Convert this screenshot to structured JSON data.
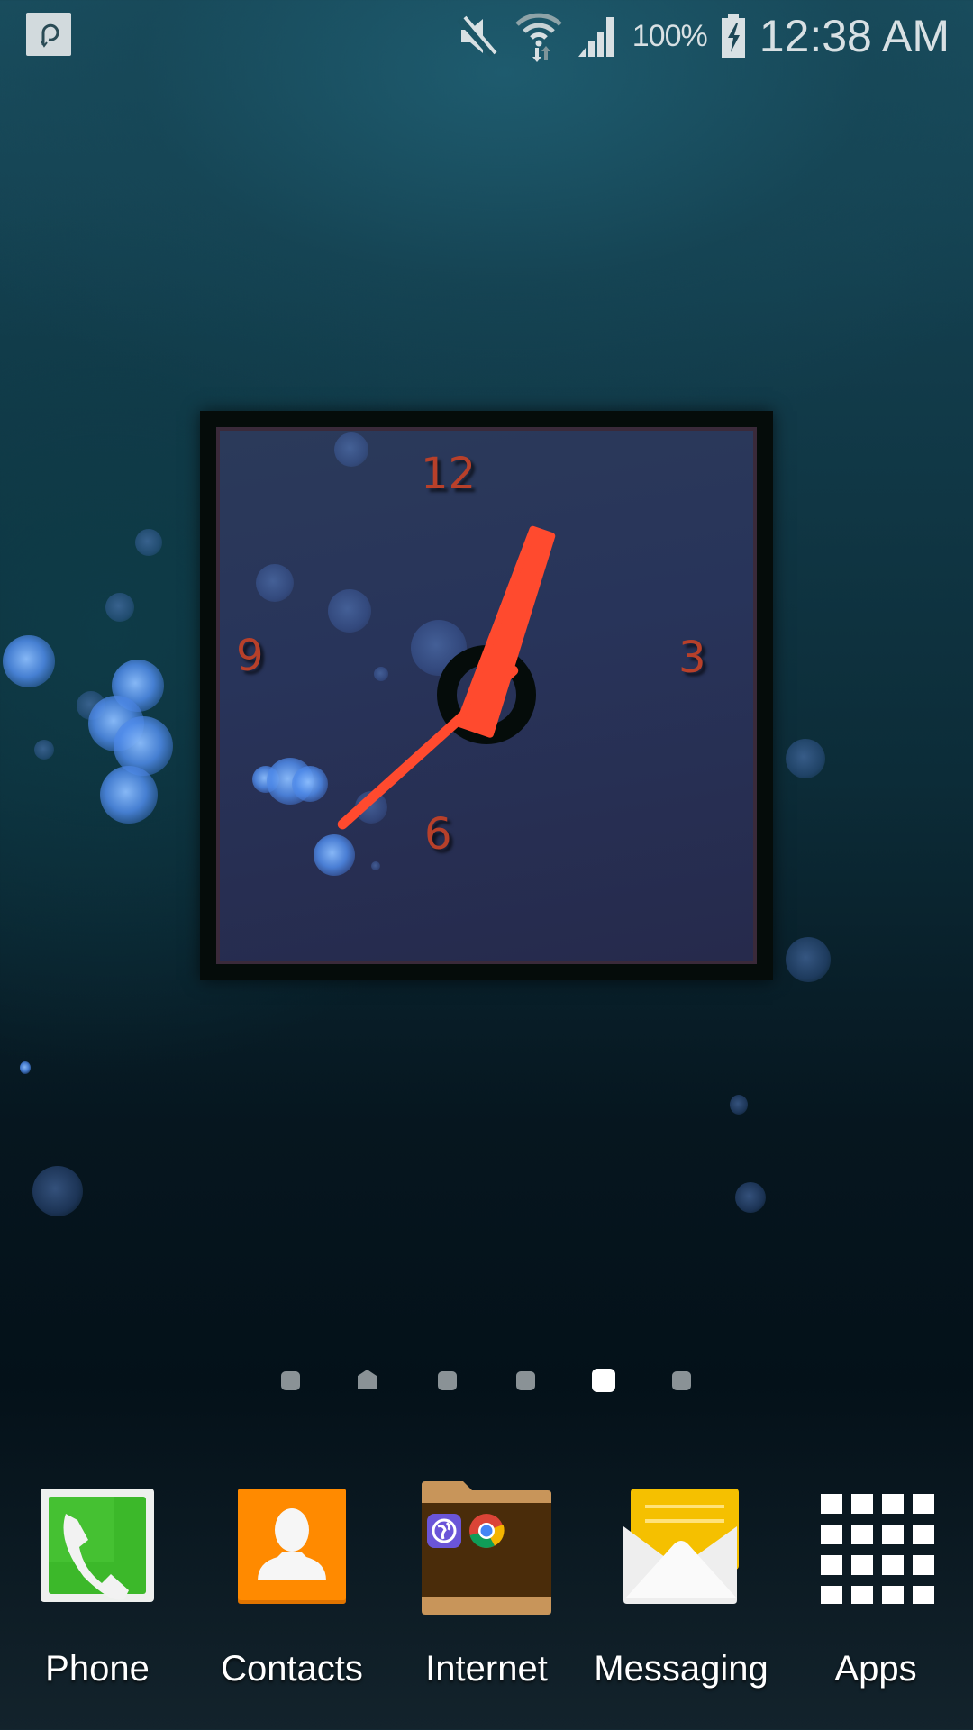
{
  "status_bar": {
    "notification_icon": "pinterest-like-p-icon",
    "icons": [
      "mute-icon",
      "wifi-icon",
      "signal-icon",
      "battery-charging-icon"
    ],
    "battery_percent": "100%",
    "time": "12:38 AM"
  },
  "clock_widget": {
    "numerals": {
      "top": "12",
      "right": "3",
      "bottom": "6",
      "left": "9"
    },
    "time": {
      "hour": 12,
      "minute": 38
    },
    "hand_color": "#ff4a2e",
    "numeral_color": "#b8402a"
  },
  "page_indicator": {
    "pages": 6,
    "home_page_index": 1,
    "active_page_index": 4
  },
  "dock": {
    "items": [
      {
        "label": "Phone",
        "icon": "phone-icon"
      },
      {
        "label": "Contacts",
        "icon": "contacts-icon"
      },
      {
        "label": "Internet",
        "icon": "folder-icon",
        "folder_contents": [
          "samsung-internet-icon",
          "chrome-icon"
        ]
      },
      {
        "label": "Messaging",
        "icon": "messaging-icon"
      },
      {
        "label": "Apps",
        "icon": "apps-grid-icon"
      }
    ]
  },
  "colors": {
    "phone_green": "#3cb82a",
    "contacts_orange": "#ff8a00",
    "folder_brown": "#4a2c0a",
    "folder_tan": "#c8955a",
    "message_yellow": "#f5c000"
  }
}
